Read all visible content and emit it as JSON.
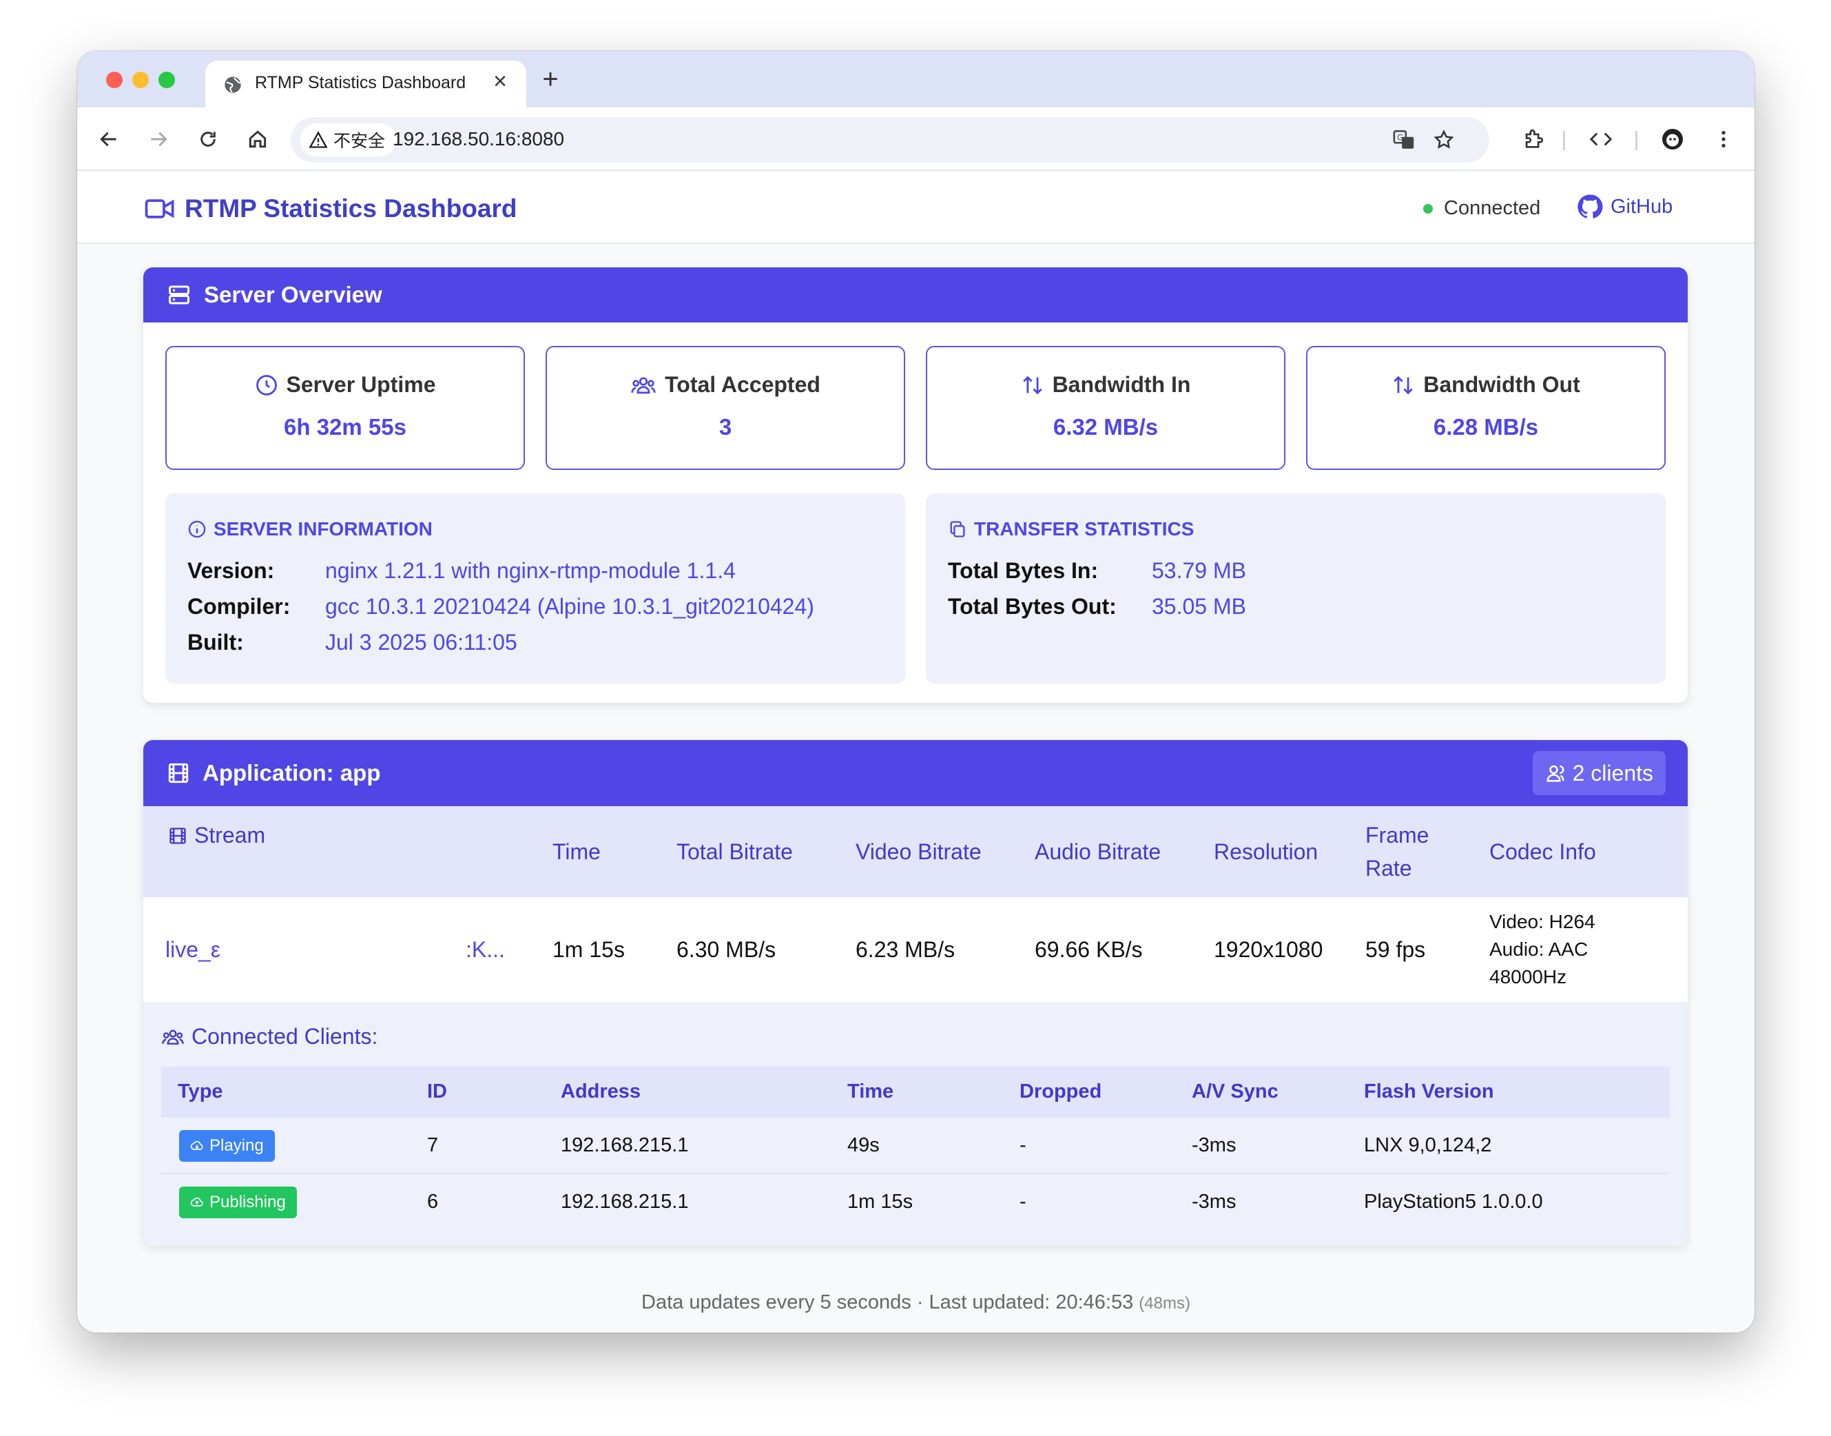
{
  "browser": {
    "tab_title": "RTMP Statistics Dashboard",
    "security_label": "不安全",
    "url": "192.168.50.16:8080"
  },
  "header": {
    "title": "RTMP Statistics Dashboard",
    "status": "Connected",
    "github": "GitHub"
  },
  "overview": {
    "title": "Server Overview",
    "stats": [
      {
        "label": "Server Uptime",
        "value": "6h 32m 55s",
        "icon": "clock-icon"
      },
      {
        "label": "Total Accepted",
        "value": "3",
        "icon": "users-icon"
      },
      {
        "label": "Bandwidth In",
        "value": "6.32 MB/s",
        "icon": "arrows-up-down-icon"
      },
      {
        "label": "Bandwidth Out",
        "value": "6.28 MB/s",
        "icon": "arrows-up-down-icon"
      }
    ],
    "server_info": {
      "heading": "SERVER INFORMATION",
      "version_label": "Version:",
      "version": "nginx 1.21.1 with nginx-rtmp-module 1.1.4",
      "compiler_label": "Compiler:",
      "compiler": "gcc 10.3.1 20210424 (Alpine 10.3.1_git20210424)",
      "built_label": "Built:",
      "built": "Jul 3 2025 06:11:05"
    },
    "transfer": {
      "heading": "TRANSFER STATISTICS",
      "in_label": "Total Bytes In:",
      "in": "53.79 MB",
      "out_label": "Total Bytes Out:",
      "out": "35.05 MB"
    }
  },
  "application": {
    "title": "Application: app",
    "clients_badge": "2 clients",
    "columns": {
      "stream": "Stream",
      "time": "Time",
      "total_bitrate": "Total Bitrate",
      "video_bitrate": "Video Bitrate",
      "audio_bitrate": "Audio Bitrate",
      "resolution": "Resolution",
      "frame_rate_1": "Frame",
      "frame_rate_2": "Rate",
      "codec": "Codec Info"
    },
    "stream": {
      "name_start": "live_ε",
      "name_end": ":K...",
      "time": "1m 15s",
      "total_bitrate": "6.30 MB/s",
      "video_bitrate": "6.23 MB/s",
      "audio_bitrate": "69.66 KB/s",
      "resolution": "1920x1080",
      "frame_rate": "59 fps",
      "codec_video": "Video: H264",
      "codec_audio": "Audio: AAC",
      "codec_rate": "48000Hz"
    },
    "clients_heading": "Connected Clients:",
    "client_columns": {
      "type": "Type",
      "id": "ID",
      "address": "Address",
      "time": "Time",
      "dropped": "Dropped",
      "av_sync": "A/V Sync",
      "flash": "Flash Version"
    },
    "clients": [
      {
        "type": "Playing",
        "id": "7",
        "address": "192.168.215.1",
        "time": "49s",
        "dropped": "-",
        "av_sync": "-3ms",
        "flash": "LNX 9,0,124,2"
      },
      {
        "type": "Publishing",
        "id": "6",
        "address": "192.168.215.1",
        "time": "1m 15s",
        "dropped": "-",
        "av_sync": "-3ms",
        "flash": "PlayStation5 1.0.0.0"
      }
    ]
  },
  "footer": {
    "text": "Data updates every 5 seconds · Last updated: 20:46:53",
    "latency": "(48ms)"
  },
  "colors": {
    "accent": "#4f46e5",
    "playing": "#3b82f6",
    "publishing": "#22c55e"
  }
}
